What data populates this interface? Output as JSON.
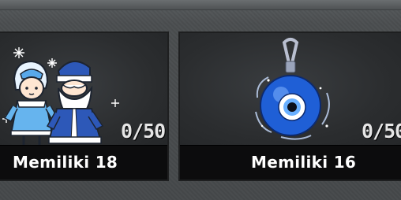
{
  "cards": [
    {
      "name": "Memiliki 18",
      "count": "0/50",
      "icon": "snow-maiden-and-father-frost-icon"
    },
    {
      "name": "Memiliki 16",
      "count": "0/50",
      "icon": "evil-eye-amulet-icon"
    }
  ],
  "colors": {
    "card_bg": "#2c2e30",
    "label_bg": "#0c0c0d",
    "text": "#ffffff",
    "amulet_blue": "#1f5fd6"
  }
}
